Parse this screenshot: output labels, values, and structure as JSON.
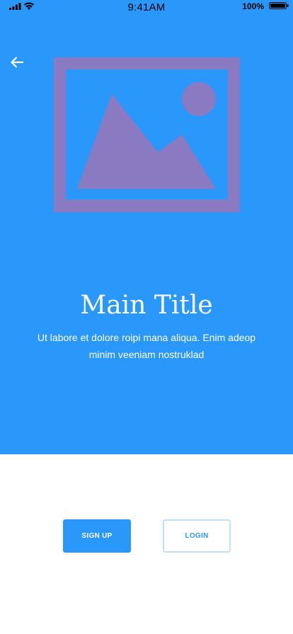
{
  "status_bar": {
    "time": "9:41AM",
    "battery_percent": "100%",
    "icons": {
      "signal": "signal-icon",
      "wifi": "wifi-icon",
      "battery": "battery-icon"
    }
  },
  "navigation": {
    "back_icon": "arrow-left-icon"
  },
  "hero": {
    "image_icon": "image-placeholder-icon",
    "title": "Main Title",
    "subtitle": "Ut labore et dolore roipi mana aliqua. Enim adeop minim veeniam nostruklad"
  },
  "actions": {
    "signup_label": "SIGN UP",
    "login_label": "LOGIN"
  },
  "colors": {
    "primary": "#2a97fb",
    "image_placeholder": "#8a7ac2",
    "background": "#ffffff",
    "login_border": "#bfe0fc"
  }
}
